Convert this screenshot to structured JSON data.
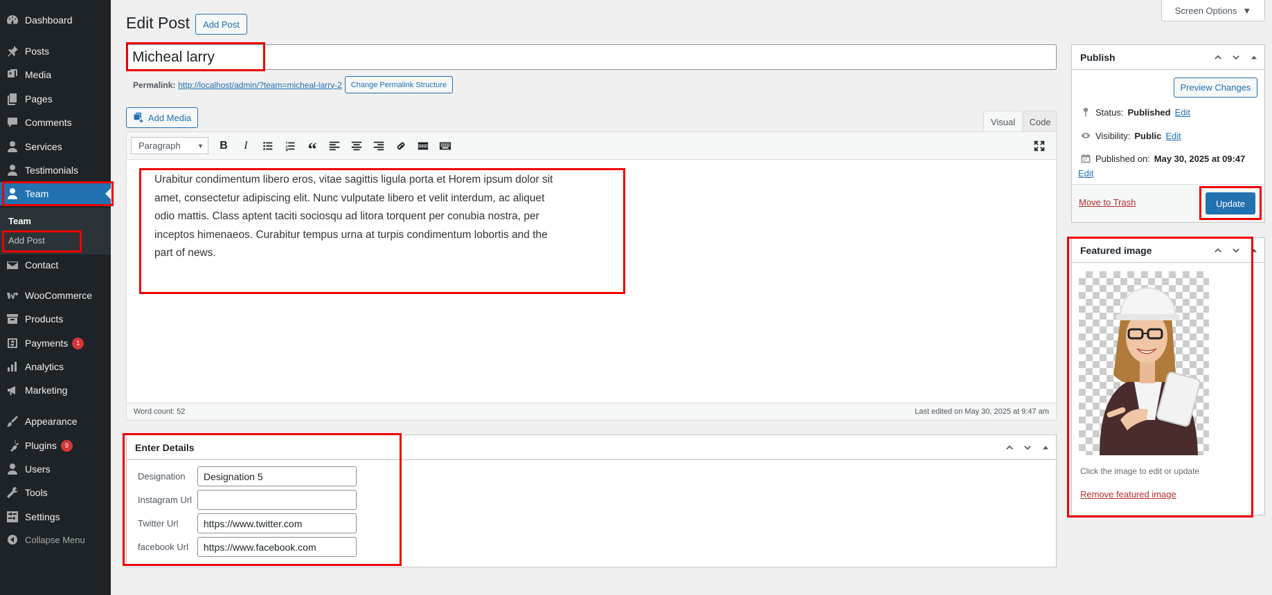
{
  "sidebar": {
    "items": [
      {
        "label": "Dashboard",
        "icon": "dashboard-icon"
      },
      {
        "label": "Posts",
        "icon": "pin-icon"
      },
      {
        "label": "Media",
        "icon": "media-icon"
      },
      {
        "label": "Pages",
        "icon": "pages-icon"
      },
      {
        "label": "Comments",
        "icon": "comments-icon"
      },
      {
        "label": "Services",
        "icon": "user-icon"
      },
      {
        "label": "Testimonials",
        "icon": "user-icon"
      },
      {
        "label": "Team",
        "icon": "user-icon"
      },
      {
        "label": "Contact",
        "icon": "email-icon"
      },
      {
        "label": "WooCommerce",
        "icon": "woo-icon"
      },
      {
        "label": "Products",
        "icon": "archive-icon"
      },
      {
        "label": "Payments",
        "icon": "dollar-icon",
        "badge": "1"
      },
      {
        "label": "Analytics",
        "icon": "bar-chart-icon"
      },
      {
        "label": "Marketing",
        "icon": "megaphone-icon"
      },
      {
        "label": "Appearance",
        "icon": "brush-icon"
      },
      {
        "label": "Plugins",
        "icon": "plug-icon",
        "badge": "9"
      },
      {
        "label": "Users",
        "icon": "user-icon"
      },
      {
        "label": "Tools",
        "icon": "wrench-icon"
      },
      {
        "label": "Settings",
        "icon": "settings-icon"
      }
    ],
    "submenu": [
      "Team",
      "Add Post"
    ],
    "collapse_label": "Collapse Menu"
  },
  "header": {
    "title": "Edit Post",
    "add_post_label": "Add Post",
    "screen_options_label": "Screen Options"
  },
  "post": {
    "title_value": "Micheal larry",
    "permalink_label": "Permalink:",
    "permalink_url": "http://localhost/admin/?team=micheal-larry-2",
    "change_permalink_label": "Change Permalink Structure"
  },
  "editor": {
    "add_media_label": "Add Media",
    "tabs": [
      "Visual",
      "Code"
    ],
    "format_value": "Paragraph",
    "content": "Urabitur condimentum libero eros, vitae sagittis ligula porta et Horem ipsum dolor sit amet, consectetur adipiscing elit. Nunc vulputate libero et velit interdum, ac aliquet odio mattis. Class aptent taciti sociosqu ad litora torquent per conubia nostra, per inceptos himenaeos. Curabitur tempus urna at turpis condimentum lobortis and the part of news.",
    "word_count": "Word count: 52",
    "last_edited": "Last edited on May 30, 2025 at 9:47 am"
  },
  "details": {
    "title": "Enter Details",
    "fields": [
      {
        "label": "Designation",
        "value": "Designation 5"
      },
      {
        "label": "Instagram Url",
        "value": ""
      },
      {
        "label": "Twitter Url",
        "value": "https://www.twitter.com"
      },
      {
        "label": "facebook Url",
        "value": "https://www.facebook.com"
      }
    ]
  },
  "publish": {
    "title": "Publish",
    "preview_label": "Preview Changes",
    "status_label": "Status:",
    "status_value": "Published",
    "visibility_label": "Visibility:",
    "visibility_value": "Public",
    "published_label": "Published on:",
    "published_value": "May 30, 2025 at 09:47",
    "edit_label": "Edit",
    "trash_label": "Move to Trash",
    "update_label": "Update"
  },
  "featured": {
    "title": "Featured image",
    "hint": "Click the image to edit or update",
    "remove_label": "Remove featured image"
  },
  "colors": {
    "sidebar_bg": "#1d2327",
    "accent": "#2271b1",
    "highlight": "#ee0000",
    "danger": "#b32d2e"
  }
}
